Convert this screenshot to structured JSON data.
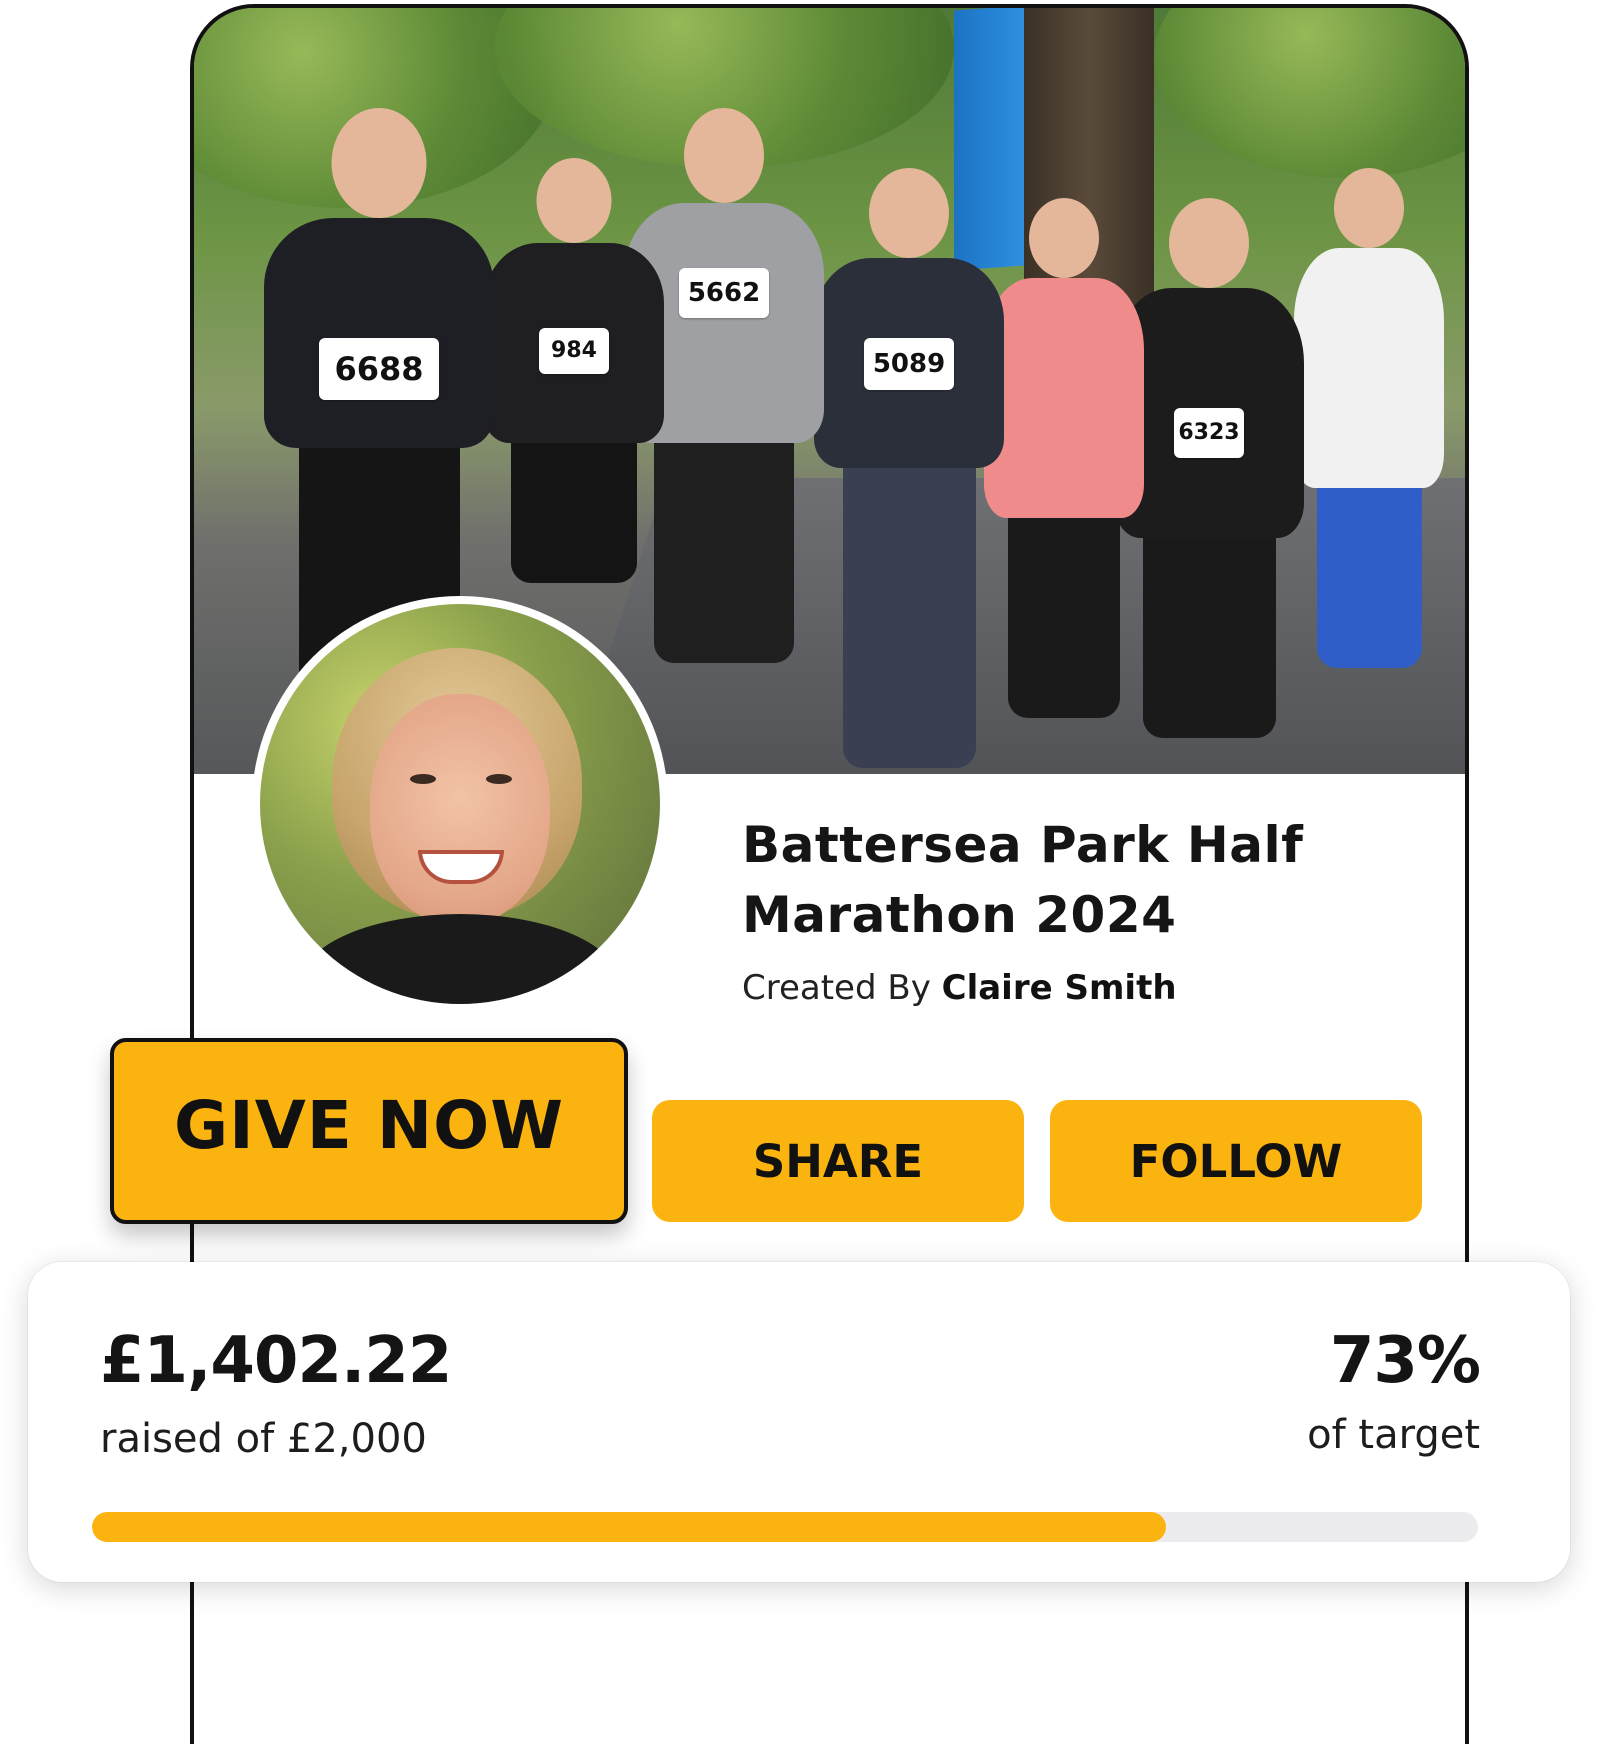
{
  "campaign": {
    "title": "Battersea Park Half Marathon 2024",
    "created_by_prefix": "Created By",
    "creator_name": "Claire Smith"
  },
  "hero": {
    "bib_numbers": [
      "6688",
      "5662",
      "5089",
      "6323",
      "984"
    ]
  },
  "actions": {
    "give_now_label": "GIVE NOW",
    "share_label": "SHARE",
    "follow_label": "FOLLOW"
  },
  "progress": {
    "raised_amount": "£1,402.22",
    "raised_of": "raised of £2,000",
    "percent_text": "73%",
    "percent_label": "of target",
    "fraction": 0.775
  },
  "colors": {
    "accent": "#fbb40f",
    "track": "#ececee",
    "text": "#141414"
  }
}
